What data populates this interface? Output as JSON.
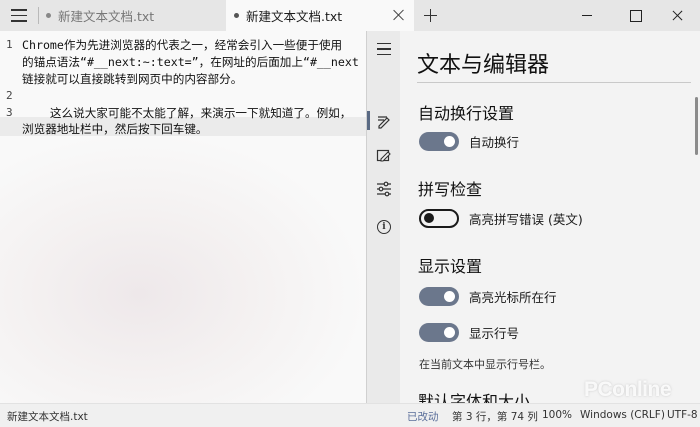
{
  "tabs": [
    {
      "label": "新建文本文档.txt",
      "active": false
    },
    {
      "label": "新建文本文档.txt",
      "active": true
    }
  ],
  "editor": {
    "line_numbers": [
      "1",
      "2",
      "3"
    ],
    "lines": [
      "Chrome作为先进浏览器的代表之一，经常会引入一些便于使用",
      "的锚点语法“#__next:~:text=”，在网址的后面加上“#__next",
      "链接就可以直接跳转到网页中的内容部分。",
      "    这么说大家可能不太能了解，来演示一下就知道了。例如，",
      "浏览器地址栏中，然后按下回车键。"
    ]
  },
  "settings": {
    "title": "文本与编辑器",
    "sections": {
      "wrap": {
        "title": "自动换行设置",
        "toggle_label": "自动换行",
        "on": true
      },
      "spell": {
        "title": "拼写检查",
        "toggle_label": "高亮拼写错误 (英文)",
        "on": false
      },
      "display": {
        "title": "显示设置",
        "highlight_label": "高亮光标所在行",
        "highlight_on": true,
        "linenum_label": "显示行号",
        "linenum_on": true,
        "hint": "在当前文本中显示行号栏。"
      },
      "font_partial": "默认字体和大小"
    }
  },
  "statusbar": {
    "file": "新建文本文档.txt",
    "modified": "已改动",
    "position": "第 3 行，第 74 列",
    "zoom": "100%",
    "eol": "Windows (CRLF)",
    "encoding": "UTF-8"
  },
  "watermark": "PConline",
  "colors": {
    "accent": "#6b778c",
    "modified_text": "#5a6e9a"
  }
}
